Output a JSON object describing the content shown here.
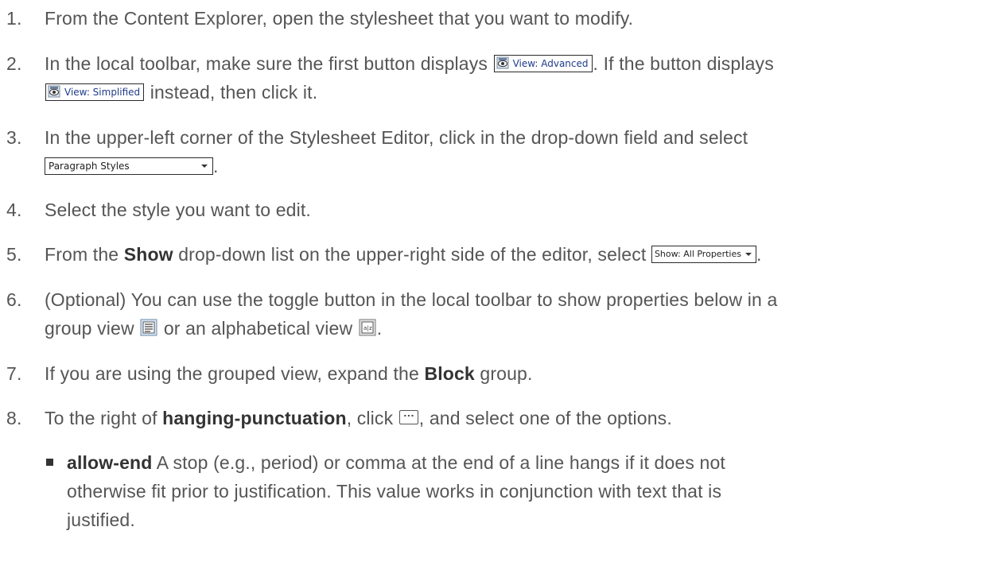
{
  "steps": [
    {
      "number": "1.",
      "text": "From the Content Explorer, open the stylesheet that you want to modify."
    },
    {
      "number": "2.",
      "before": "In the local toolbar, make sure the first button displays ",
      "button1": "View: Advanced",
      "middle": ". If the button displays",
      "button2": "View: Simplified",
      "after": " instead, then click it.",
      "icon": "view-eye-icon"
    },
    {
      "number": "3.",
      "text": "In the upper-left corner of the Stylesheet Editor, click in the drop-down field and select",
      "select_value": "Paragraph Styles",
      "after": "."
    },
    {
      "number": "4.",
      "text": "Select the style you want to edit."
    },
    {
      "number": "5.",
      "before": "From the ",
      "bold": "Show",
      "after": " drop-down list on the upper-right side of the editor, select ",
      "select_value": "Show: All Properties",
      "end": "."
    },
    {
      "number": "6.",
      "line1": "(Optional) You can use the toggle button in the local toolbar to show properties below in a",
      "line2a": "group view ",
      "line2b": " or an alphabetical view ",
      "line2c": ".",
      "icons": [
        "group-view-icon",
        "alphabetical-view-icon"
      ]
    },
    {
      "number": "7.",
      "before": "If you are using the grouped view, expand the ",
      "bold": "Block",
      "after": " group."
    },
    {
      "number": "8.",
      "before": "To the right of ",
      "bold": "hanging-punctuation",
      "middle": ", click ",
      "after": ", and select one of the options.",
      "icon": "ellipsis-icon"
    }
  ],
  "options": [
    {
      "bold": "allow-end",
      "line1": " A stop (e.g., period) or comma at the end of a line hangs if it does not",
      "line2": "otherwise fit prior to justification. This value works in conjunction with text that is",
      "line3": "justified."
    }
  ],
  "colors": {
    "text": "#555555",
    "bold": "#333333",
    "widget_text": "#1f3b8a",
    "widget_border": "#2b2b2b"
  }
}
